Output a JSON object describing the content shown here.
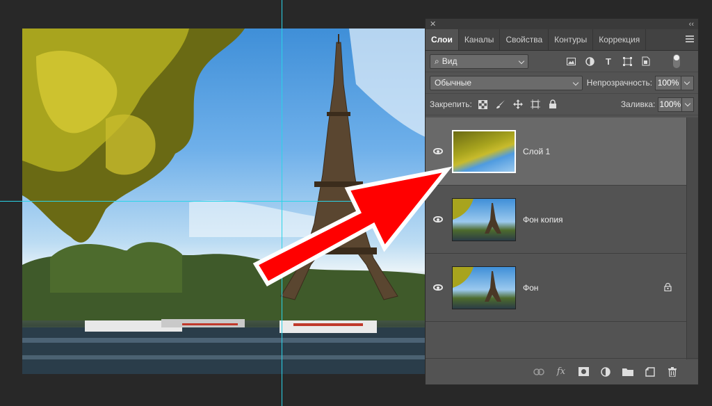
{
  "panel": {
    "close_glyph": "✕",
    "collapse_glyph": "‹‹",
    "tabs": [
      {
        "label": "Слои",
        "active": true
      },
      {
        "label": "Каналы"
      },
      {
        "label": "Свойства"
      },
      {
        "label": "Контуры"
      },
      {
        "label": "Коррекция"
      }
    ],
    "filter": {
      "icon": "search-icon",
      "value": "Вид"
    },
    "blend": {
      "value": "Обычные",
      "opacity_label": "Непрозрачность:",
      "opacity_value": "100%"
    },
    "lock": {
      "label": "Закрепить:",
      "fill_label": "Заливка:",
      "fill_value": "100%"
    },
    "layers": [
      {
        "name": "Слой 1",
        "selected": true
      },
      {
        "name": "Фон копия"
      },
      {
        "name": "Фон",
        "locked": true
      }
    ],
    "footer_fx": "fx"
  },
  "colors": {
    "guide": "#2ad4e8",
    "arrow": "#ff0000",
    "panel_bg": "#535353"
  }
}
